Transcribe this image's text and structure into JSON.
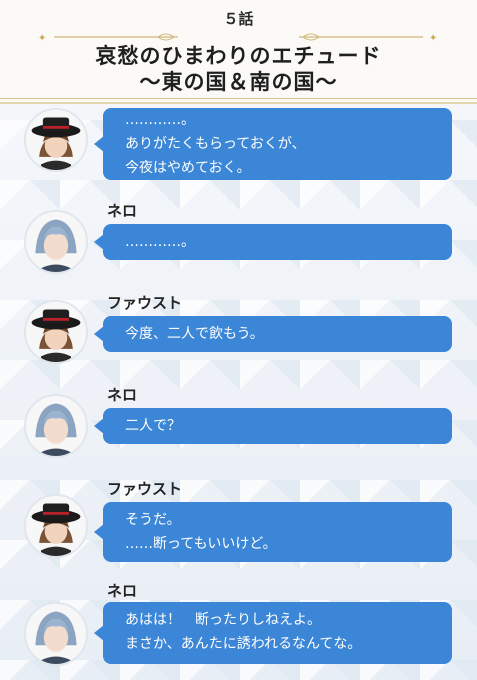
{
  "header": {
    "episode": "５話",
    "title_line1": "哀愁のひまわりのエチュード",
    "title_line2": "〜東の国＆南の国〜"
  },
  "colors": {
    "bubble": "#3b86d6",
    "gold": "#d9c48f"
  },
  "messages": [
    {
      "speaker": "",
      "avatar": "faust-avatar",
      "lines": [
        "…………。",
        "ありがたくもらっておくが、",
        "今夜はやめておく。"
      ]
    },
    {
      "speaker": "ネロ",
      "avatar": "nero-avatar",
      "lines": [
        "…………。"
      ]
    },
    {
      "speaker": "ファウスト",
      "avatar": "faust-avatar",
      "lines": [
        "今度、二人で飲もう。"
      ]
    },
    {
      "speaker": "ネロ",
      "avatar": "nero-avatar",
      "lines": [
        "二人で？"
      ]
    },
    {
      "speaker": "ファウスト",
      "avatar": "faust-avatar",
      "lines": [
        "そうだ。",
        "……断ってもいいけど。"
      ]
    },
    {
      "speaker": "ネロ",
      "avatar": "nero-avatar",
      "lines": [
        "あはは！　断ったりしねえよ。",
        "まさか、あんたに誘われるなんてな。"
      ]
    }
  ]
}
